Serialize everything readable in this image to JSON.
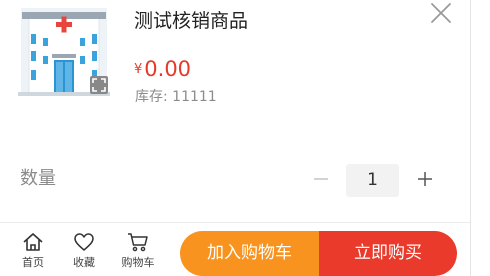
{
  "product": {
    "title": "测试核销商品",
    "currency": "¥",
    "price": "0.00",
    "stock": "库存: 11111",
    "image_icon": "hospital-building-icon"
  },
  "quantity": {
    "label": "数量",
    "value": "1"
  },
  "bottom_nav": {
    "home_label": "首页",
    "favorite_label": "收藏",
    "cart_label": "购物车"
  },
  "actions": {
    "add_to_cart": "加入购物车",
    "buy_now": "立即购买"
  },
  "colors": {
    "price": "#e8382a",
    "add_to_cart_bg": "#f7931e",
    "buy_now_bg": "#ea3a2b"
  }
}
